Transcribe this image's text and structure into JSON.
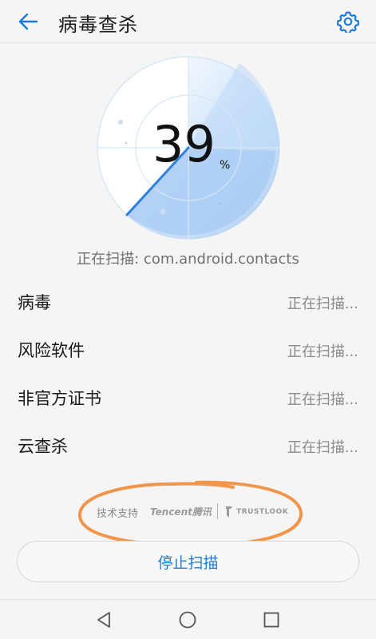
{
  "header": {
    "title": "病毒查杀",
    "back_icon": "arrow-left-icon",
    "settings_icon": "gear-icon"
  },
  "scan": {
    "progress_percent": 39,
    "progress_display": "39",
    "percent_sign": "%",
    "status_text": "正在扫描: com.android.contacts"
  },
  "items": [
    {
      "label": "病毒",
      "status": "正在扫描..."
    },
    {
      "label": "风险软件",
      "status": "正在扫描..."
    },
    {
      "label": "非官方证书",
      "status": "正在扫描..."
    },
    {
      "label": "云查杀",
      "status": "正在扫描..."
    }
  ],
  "support": {
    "label": "技术支持",
    "tencent": "Tencent腾讯",
    "trustlook": "TRUSTLOOK"
  },
  "stop_button": {
    "label": "停止扫描"
  },
  "colors": {
    "accent": "#1d7bd8",
    "radar_fill": "#cfe3fb",
    "highlight": "#f0954a"
  },
  "navbar": {
    "back_icon": "triangle-back-icon",
    "home_icon": "circle-home-icon",
    "recent_icon": "square-recent-icon"
  }
}
